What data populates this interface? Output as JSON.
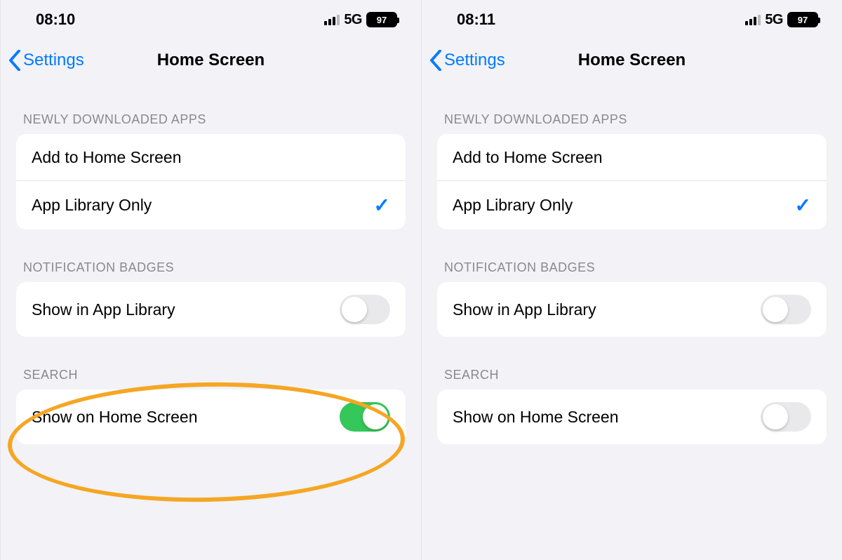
{
  "phones": [
    {
      "time": "08:10",
      "network": "5G",
      "battery": "97",
      "back_label": "Settings",
      "title": "Home Screen",
      "section1_header": "Newly Downloaded Apps",
      "option_add": "Add to Home Screen",
      "option_lib": "App Library Only",
      "section2_header": "Notification Badges",
      "badge_row": "Show in App Library",
      "badge_on": false,
      "section3_header": "Search",
      "search_row": "Show on Home Screen",
      "search_on": true,
      "selected_option": "lib",
      "highlight_search": true
    },
    {
      "time": "08:11",
      "network": "5G",
      "battery": "97",
      "back_label": "Settings",
      "title": "Home Screen",
      "section1_header": "Newly Downloaded Apps",
      "option_add": "Add to Home Screen",
      "option_lib": "App Library Only",
      "section2_header": "Notification Badges",
      "badge_row": "Show in App Library",
      "badge_on": false,
      "section3_header": "Search",
      "search_row": "Show on Home Screen",
      "search_on": false,
      "selected_option": "lib",
      "highlight_search": false
    }
  ],
  "annotation_color": "#f5a623"
}
